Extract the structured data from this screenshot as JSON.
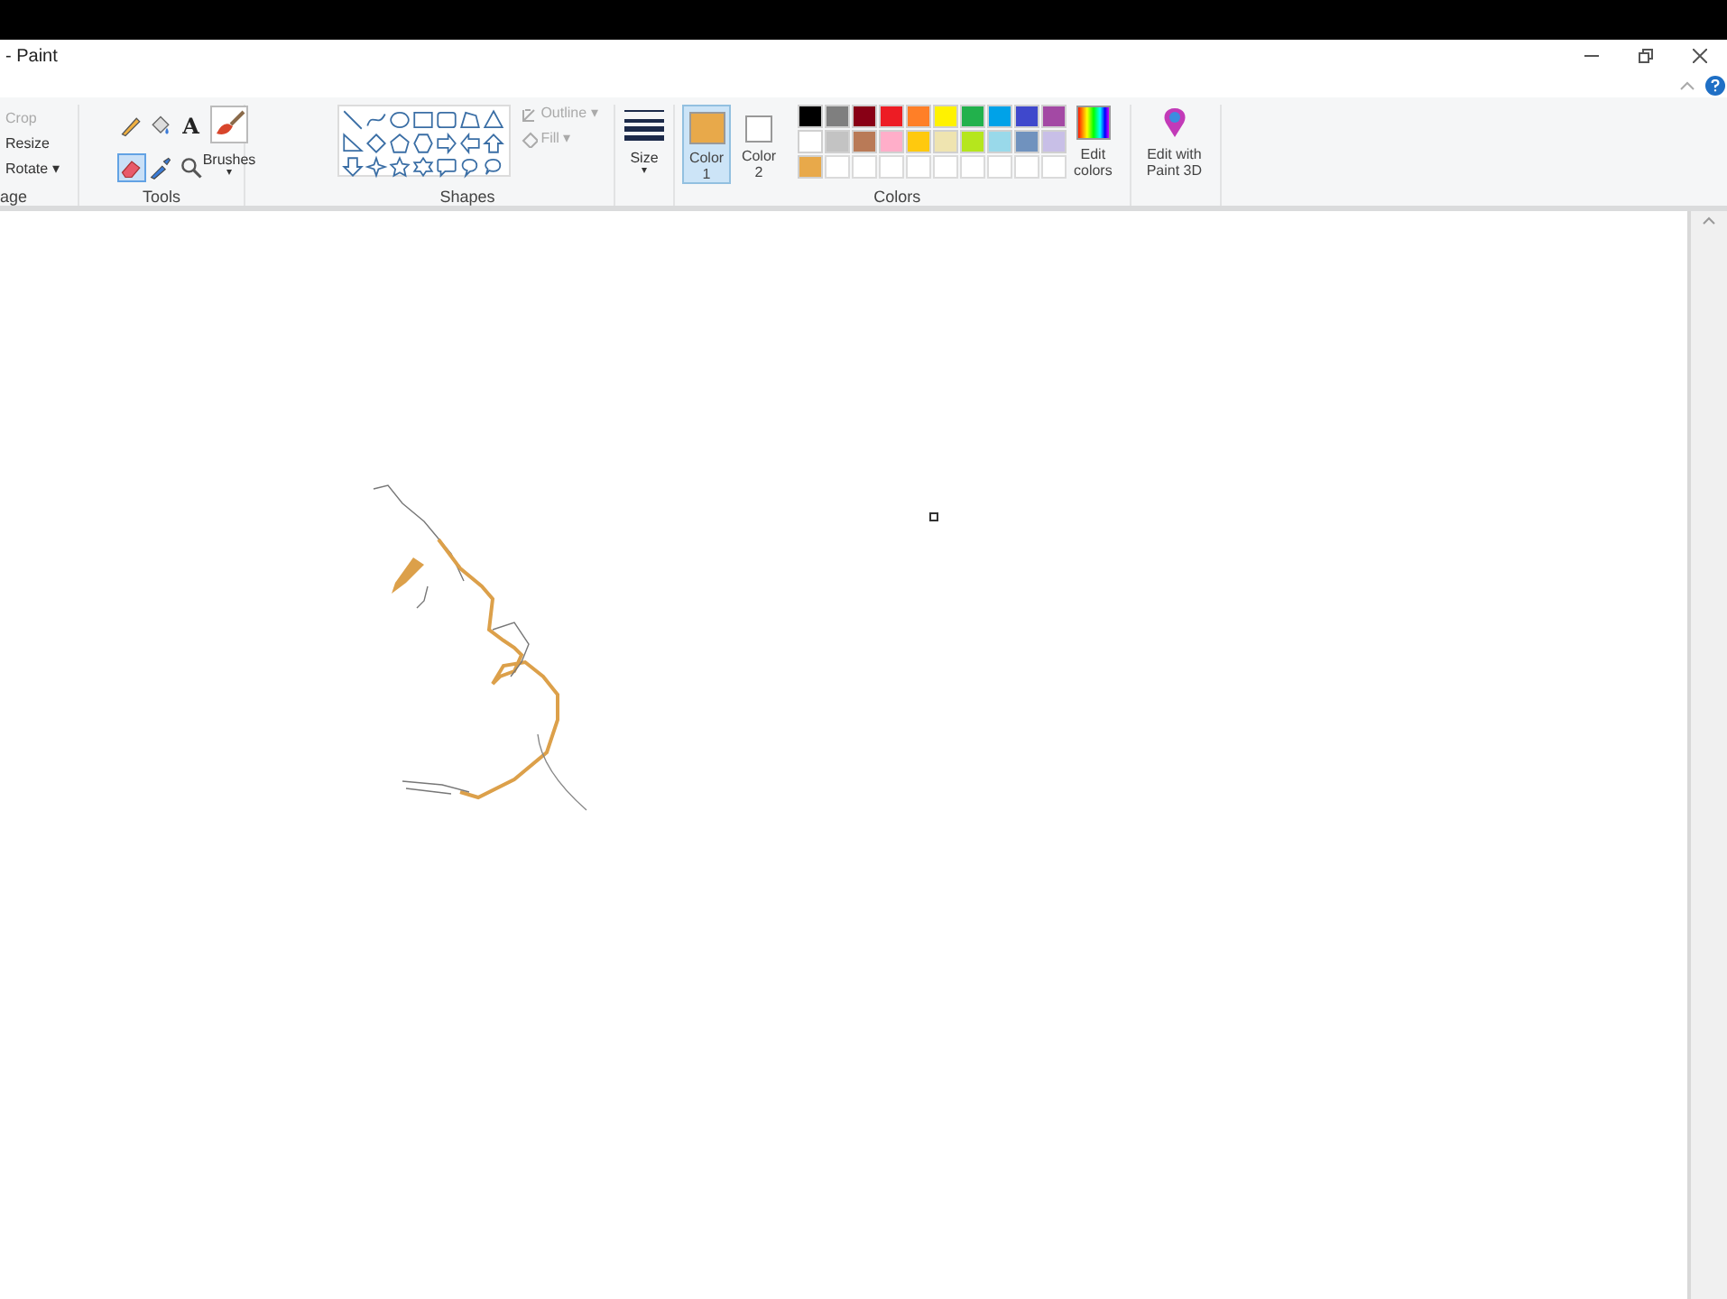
{
  "window": {
    "title": "- Paint"
  },
  "image_group": {
    "items": [
      {
        "label": "Crop",
        "disabled": true
      },
      {
        "label": "Resize",
        "disabled": false
      },
      {
        "label": "Rotate",
        "caret": "▾",
        "disabled": false
      }
    ],
    "caption": "age"
  },
  "tools": {
    "items": [
      {
        "kind": "pencil",
        "selected": false
      },
      {
        "kind": "fill",
        "selected": false
      },
      {
        "kind": "text",
        "label": "A",
        "selected": false
      },
      {
        "kind": "eraser",
        "selected": true
      },
      {
        "kind": "picker",
        "selected": false
      },
      {
        "kind": "magnifier",
        "selected": false
      }
    ],
    "caption": "Tools"
  },
  "brushes": {
    "label": "Brushes",
    "caret": "▾"
  },
  "shapes": {
    "caption": "Shapes",
    "outline": {
      "label": "Outline",
      "caret": "▾",
      "disabled": true
    },
    "fill": {
      "label": "Fill",
      "caret": "▾",
      "disabled": true
    }
  },
  "size": {
    "label": "Size",
    "caret": "▾"
  },
  "color_slots": [
    {
      "label": "Color",
      "sub": "1",
      "color": "#e8a94a",
      "selected": true
    },
    {
      "label": "Color",
      "sub": "2",
      "color": "#ffffff",
      "selected": false
    }
  ],
  "palette": {
    "caption": "Colors",
    "rows": [
      [
        {
          "kind": "color",
          "color": "#000000"
        },
        {
          "kind": "color",
          "color": "#7f7f7f"
        },
        {
          "kind": "color",
          "color": "#880015"
        },
        {
          "kind": "color",
          "color": "#ed1c24"
        },
        {
          "kind": "color",
          "color": "#ff7f27"
        },
        {
          "kind": "color",
          "color": "#fff200"
        },
        {
          "kind": "color",
          "color": "#22b14c"
        },
        {
          "kind": "color",
          "color": "#00a2e8"
        },
        {
          "kind": "color",
          "color": "#3f48cc"
        },
        {
          "kind": "color",
          "color": "#a349a4"
        }
      ],
      [
        {
          "kind": "color",
          "color": "#ffffff"
        },
        {
          "kind": "color",
          "color": "#c3c3c3"
        },
        {
          "kind": "color",
          "color": "#b97a57"
        },
        {
          "kind": "color",
          "color": "#ffaec9"
        },
        {
          "kind": "color",
          "color": "#ffc90e"
        },
        {
          "kind": "color",
          "color": "#efe4b0"
        },
        {
          "kind": "color",
          "color": "#b5e61d"
        },
        {
          "kind": "color",
          "color": "#99d9ea"
        },
        {
          "kind": "color",
          "color": "#7092be"
        },
        {
          "kind": "color",
          "color": "#c8bfe7"
        }
      ],
      [
        {
          "kind": "color",
          "color": "#e8a94a"
        },
        {
          "kind": "empty"
        },
        {
          "kind": "empty"
        },
        {
          "kind": "empty"
        },
        {
          "kind": "empty"
        },
        {
          "kind": "empty"
        },
        {
          "kind": "empty"
        },
        {
          "kind": "empty"
        },
        {
          "kind": "empty"
        },
        {
          "kind": "empty"
        }
      ]
    ]
  },
  "edit_colors": {
    "label": "Edit",
    "sub": "colors"
  },
  "paint3d": {
    "label": "Edit with",
    "sub": "Paint 3D"
  }
}
